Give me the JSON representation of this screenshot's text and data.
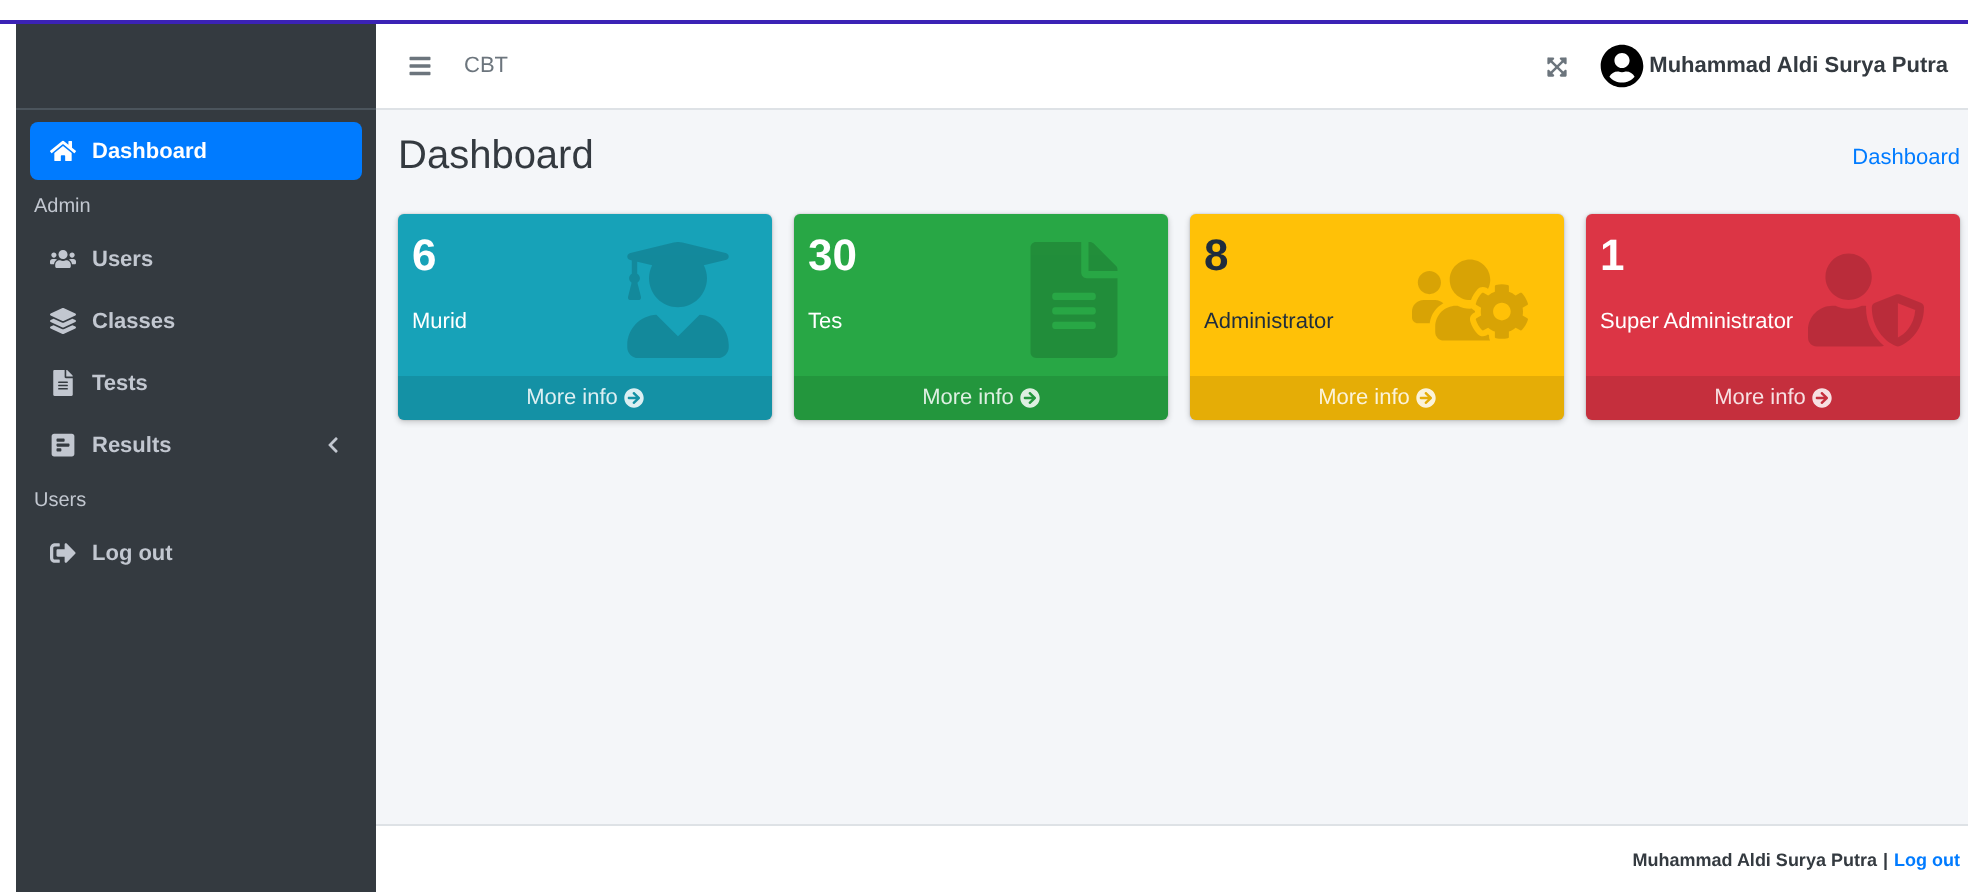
{
  "topbar": {
    "brand": "CBT",
    "user": "Muhammad Aldi Surya Putra"
  },
  "sidebar": {
    "items": [
      {
        "kind": "link",
        "label": "Dashboard",
        "selected": true
      },
      {
        "kind": "header",
        "label": "Admin"
      },
      {
        "kind": "link",
        "label": "Users",
        "selected": false
      },
      {
        "kind": "link",
        "label": "Classes",
        "selected": false
      },
      {
        "kind": "link",
        "label": "Tests",
        "selected": false
      },
      {
        "kind": "link",
        "label": "Results",
        "selected": false,
        "expanded": false
      },
      {
        "kind": "header",
        "label": "Users"
      },
      {
        "kind": "link",
        "label": "Log out",
        "selected": false
      }
    ]
  },
  "page": {
    "title": "Dashboard",
    "breadcrumb": "Dashboard"
  },
  "cards": [
    {
      "count": "6",
      "label": "Murid",
      "link": "More info",
      "color": "#17a2b8"
    },
    {
      "count": "30",
      "label": "Tes",
      "link": "More info",
      "color": "#28a745"
    },
    {
      "count": "8",
      "label": "Administrator",
      "link": "More info",
      "color": "#ffc107"
    },
    {
      "count": "1",
      "label": "Super Administrator",
      "link": "More info",
      "color": "#dc3545"
    }
  ],
  "footer": {
    "user": "Muhammad Aldi Surya Putra",
    "separator": "|",
    "link": "Log out"
  }
}
